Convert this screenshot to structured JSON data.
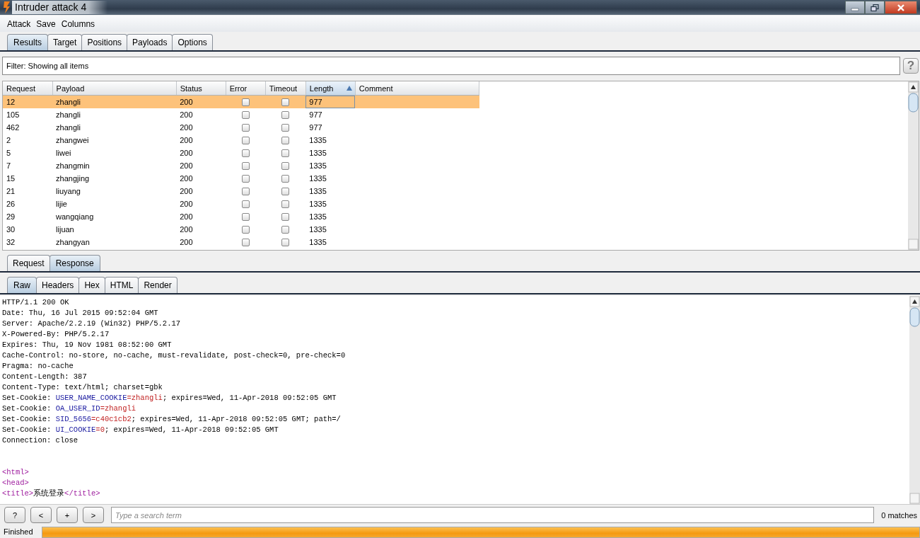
{
  "window": {
    "title": "Intruder attack 4"
  },
  "menu": [
    "Attack",
    "Save",
    "Columns"
  ],
  "tabs": [
    {
      "label": "Results",
      "selected": true
    },
    {
      "label": "Target",
      "selected": false
    },
    {
      "label": "Positions",
      "selected": false
    },
    {
      "label": "Payloads",
      "selected": false
    },
    {
      "label": "Options",
      "selected": false
    }
  ],
  "filter": {
    "text": "Filter:  Showing all items",
    "help": "?"
  },
  "table": {
    "columns": [
      {
        "label": "Request",
        "sorted": false
      },
      {
        "label": "Payload",
        "sorted": false
      },
      {
        "label": "Status",
        "sorted": false
      },
      {
        "label": "Error",
        "sorted": false
      },
      {
        "label": "Timeout",
        "sorted": false
      },
      {
        "label": "Length",
        "sorted": true
      },
      {
        "label": "Comment",
        "sorted": false
      }
    ],
    "rows": [
      {
        "request": "12",
        "payload": "zhangli",
        "status": "200",
        "error": false,
        "timeout": false,
        "length": "977",
        "selected": true
      },
      {
        "request": "105",
        "payload": "zhangli",
        "status": "200",
        "error": false,
        "timeout": false,
        "length": "977",
        "selected": false
      },
      {
        "request": "462",
        "payload": "zhangli",
        "status": "200",
        "error": false,
        "timeout": false,
        "length": "977",
        "selected": false
      },
      {
        "request": "2",
        "payload": "zhangwei",
        "status": "200",
        "error": false,
        "timeout": false,
        "length": "1335",
        "selected": false
      },
      {
        "request": "5",
        "payload": "liwei",
        "status": "200",
        "error": false,
        "timeout": false,
        "length": "1335",
        "selected": false
      },
      {
        "request": "7",
        "payload": "zhangmin",
        "status": "200",
        "error": false,
        "timeout": false,
        "length": "1335",
        "selected": false
      },
      {
        "request": "15",
        "payload": "zhangjing",
        "status": "200",
        "error": false,
        "timeout": false,
        "length": "1335",
        "selected": false
      },
      {
        "request": "21",
        "payload": "liuyang",
        "status": "200",
        "error": false,
        "timeout": false,
        "length": "1335",
        "selected": false
      },
      {
        "request": "26",
        "payload": "lijie",
        "status": "200",
        "error": false,
        "timeout": false,
        "length": "1335",
        "selected": false
      },
      {
        "request": "29",
        "payload": "wangqiang",
        "status": "200",
        "error": false,
        "timeout": false,
        "length": "1335",
        "selected": false
      },
      {
        "request": "30",
        "payload": "lijuan",
        "status": "200",
        "error": false,
        "timeout": false,
        "length": "1335",
        "selected": false
      },
      {
        "request": "32",
        "payload": "zhangyan",
        "status": "200",
        "error": false,
        "timeout": false,
        "length": "1335",
        "selected": false
      }
    ]
  },
  "message_tabs": [
    {
      "label": "Request",
      "selected": false
    },
    {
      "label": "Response",
      "selected": true
    }
  ],
  "view_tabs": [
    {
      "label": "Raw",
      "selected": true
    },
    {
      "label": "Headers",
      "selected": false
    },
    {
      "label": "Hex",
      "selected": false
    },
    {
      "label": "HTML",
      "selected": false
    },
    {
      "label": "Render",
      "selected": false
    }
  ],
  "response": {
    "lines": [
      {
        "kind": "text",
        "segments": [
          {
            "kind": "plain",
            "text": "HTTP/1.1 200 OK"
          }
        ]
      },
      {
        "kind": "text",
        "segments": [
          {
            "kind": "plain",
            "text": "Date: Thu, 16 Jul 2015 09:52:04 GMT"
          }
        ]
      },
      {
        "kind": "text",
        "segments": [
          {
            "kind": "plain",
            "text": "Server: Apache/2.2.19 (Win32) PHP/5.2.17"
          }
        ]
      },
      {
        "kind": "text",
        "segments": [
          {
            "kind": "plain",
            "text": "X-Powered-By: PHP/5.2.17"
          }
        ]
      },
      {
        "kind": "text",
        "segments": [
          {
            "kind": "plain",
            "text": "Expires: Thu, 19 Nov 1981 08:52:00 GMT"
          }
        ]
      },
      {
        "kind": "text",
        "segments": [
          {
            "kind": "plain",
            "text": "Cache-Control: no-store, no-cache, must-revalidate, post-check=0, pre-check=0"
          }
        ]
      },
      {
        "kind": "text",
        "segments": [
          {
            "kind": "plain",
            "text": "Pragma: no-cache"
          }
        ]
      },
      {
        "kind": "text",
        "segments": [
          {
            "kind": "plain",
            "text": "Content-Length: 387"
          }
        ]
      },
      {
        "kind": "text",
        "segments": [
          {
            "kind": "plain",
            "text": "Content-Type: text/html; charset=gbk"
          }
        ]
      },
      {
        "kind": "text",
        "segments": [
          {
            "kind": "plain",
            "text": "Set-Cookie: "
          },
          {
            "kind": "name",
            "text": "USER_NAME_COOKIE"
          },
          {
            "kind": "value",
            "text": "=zhangli"
          },
          {
            "kind": "plain",
            "text": "; expires=Wed, 11-Apr-2018 09:52:05 GMT"
          }
        ]
      },
      {
        "kind": "text",
        "segments": [
          {
            "kind": "plain",
            "text": "Set-Cookie: "
          },
          {
            "kind": "name",
            "text": "OA_USER_ID"
          },
          {
            "kind": "value",
            "text": "=zhangli"
          }
        ]
      },
      {
        "kind": "text",
        "segments": [
          {
            "kind": "plain",
            "text": "Set-Cookie: "
          },
          {
            "kind": "name",
            "text": "SID_5656"
          },
          {
            "kind": "value",
            "text": "=c40c1cb2"
          },
          {
            "kind": "plain",
            "text": "; expires=Wed, 11-Apr-2018 09:52:05 GMT; path=/"
          }
        ]
      },
      {
        "kind": "text",
        "segments": [
          {
            "kind": "plain",
            "text": "Set-Cookie: "
          },
          {
            "kind": "name",
            "text": "UI_COOKIE"
          },
          {
            "kind": "value",
            "text": "=0"
          },
          {
            "kind": "plain",
            "text": "; expires=Wed, 11-Apr-2018 09:52:05 GMT"
          }
        ]
      },
      {
        "kind": "text",
        "segments": [
          {
            "kind": "plain",
            "text": "Connection: close"
          }
        ]
      },
      {
        "kind": "blank"
      },
      {
        "kind": "blank"
      },
      {
        "kind": "text",
        "segments": [
          {
            "kind": "tag",
            "text": "<html>"
          }
        ]
      },
      {
        "kind": "text",
        "segments": [
          {
            "kind": "tag",
            "text": "<head>"
          }
        ]
      },
      {
        "kind": "text",
        "segments": [
          {
            "kind": "tag",
            "text": "<title>"
          },
          {
            "kind": "plain",
            "text": "系统登录"
          },
          {
            "kind": "tag",
            "text": "</title>"
          }
        ]
      }
    ]
  },
  "search": {
    "buttons": [
      "?",
      "<",
      "+",
      ">"
    ],
    "placeholder": "Type a search term",
    "matches": "0 matches"
  },
  "status_bar": {
    "text": "Finished",
    "level": 1
  }
}
